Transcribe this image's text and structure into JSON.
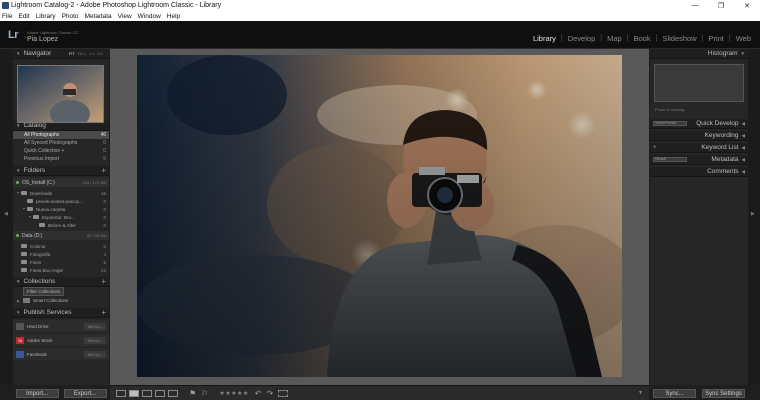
{
  "window": {
    "title": "Lightroom Catalog-2 - Adobe Photoshop Lightroom Classic - Library",
    "minimize": "—",
    "maximize": "❐",
    "close": "✕"
  },
  "menu": [
    "File",
    "Edit",
    "Library",
    "Photo",
    "Metadata",
    "View",
    "Window",
    "Help"
  ],
  "identity": {
    "logo": "Lr",
    "product": "Adobe Lightroom Classic CC",
    "user": "Pia Lopez"
  },
  "modules": [
    "Library",
    "Develop",
    "Map",
    "Book",
    "Slideshow",
    "Print",
    "Web"
  ],
  "active_module": "Library",
  "left": {
    "navigator": {
      "title": "Navigator",
      "zoom": [
        "FIT",
        "FILL",
        "1:1",
        "3:1"
      ]
    },
    "catalog": {
      "title": "Catalog",
      "items": [
        {
          "label": "All Photographs",
          "count": "46"
        },
        {
          "label": "All Synced Photographs",
          "count": "0"
        },
        {
          "label": "Quick Collection +",
          "count": "0"
        },
        {
          "label": "Previous Import",
          "count": "5"
        }
      ]
    },
    "folders": {
      "title": "Folders",
      "volume1": {
        "label": "OS_Install (C:)",
        "info": "133 / 171 GB"
      },
      "tree1": [
        {
          "tri": "▼",
          "label": "Downloads",
          "count": "15",
          "indent": 2
        },
        {
          "tri": "",
          "label": "pexels-andrea-piacqu...",
          "count": "0",
          "indent": 8
        },
        {
          "tri": "▼",
          "label": "Nueva carpeta",
          "count": "0",
          "indent": 8
        },
        {
          "tri": "▼",
          "label": "Expoertar: Bro...",
          "count": "0",
          "indent": 14
        },
        {
          "tri": "",
          "label": "Before & After",
          "count": "0",
          "indent": 20
        }
      ],
      "volume2": {
        "label": "Data (D:)",
        "info": "52 / 99 GB"
      },
      "tree2": [
        {
          "tri": "",
          "label": "Colonia",
          "count": "0",
          "indent": 2
        },
        {
          "tri": "",
          "label": "Fotografia",
          "count": "4",
          "indent": 2
        },
        {
          "tri": "",
          "label": "Fotos",
          "count": "5",
          "indent": 2
        },
        {
          "tri": "",
          "label": "Fotos Boo Angie",
          "count": "22",
          "indent": 2
        }
      ]
    },
    "collections": {
      "title": "Collections",
      "items": [
        {
          "label": "Filter Collections",
          "tri": ""
        },
        {
          "label": "Smart Collections",
          "tri": "▶"
        }
      ]
    },
    "publish": {
      "title": "Publish Services",
      "items": [
        {
          "label": "Hard Drive",
          "setup": "Set Up...",
          "icon": ""
        },
        {
          "label": "Adobe Stock",
          "setup": "Set Up...",
          "icon": "St"
        },
        {
          "label": "Facebook",
          "setup": "Set Up...",
          "icon": ""
        }
      ]
    },
    "buttons": {
      "import": "Import...",
      "export": "Export..."
    }
  },
  "right": {
    "histogram": {
      "title": "Histogram",
      "note": "Photo is missing"
    },
    "quick_develop": {
      "title": "Quick Develop",
      "preset": "Saved Preset"
    },
    "keywording": {
      "title": "Keywording"
    },
    "keyword_list": {
      "title": "Keyword List"
    },
    "metadata": {
      "title": "Metadata",
      "preset": "Default"
    },
    "comments": {
      "title": "Comments"
    },
    "buttons": {
      "sync": "Sync...",
      "sync_settings": "Sync Settings"
    }
  },
  "toolbar": {
    "stars": "★★★★★"
  },
  "colors": {
    "panel_bg": "#262626",
    "loupe_bg": "#595959",
    "selected_row": "#4a4a4a",
    "adobe_stock_red": "#c2292f"
  }
}
